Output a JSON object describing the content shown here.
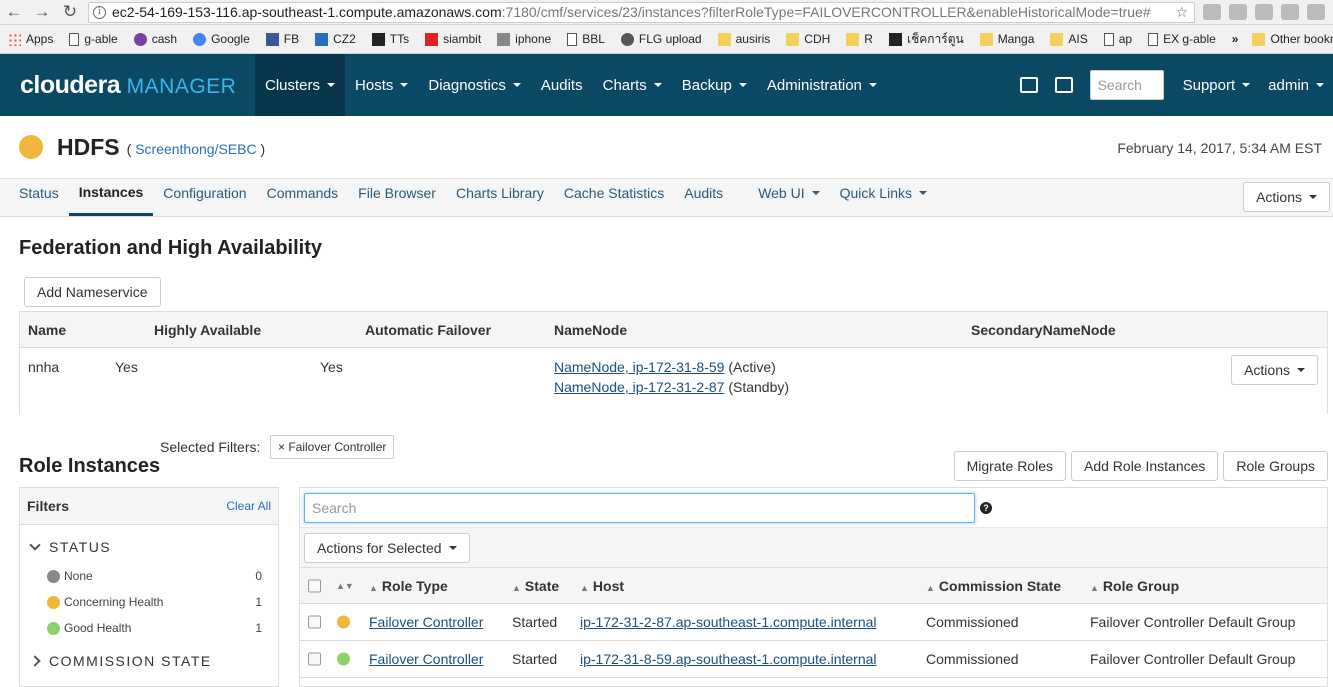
{
  "browser": {
    "url_host": "ec2-54-169-153-116.ap-southeast-1.compute.amazonaws.com",
    "url_path": ":7180/cmf/services/23/instances?filterRoleType=FAILOVERCONTROLLER&enableHistoricalMode=true#",
    "bookmarks": [
      "Apps",
      "g-able",
      "cash",
      "Google",
      "FB",
      "CZ2",
      "TTs",
      "siambit",
      "iphone",
      "BBL",
      "FLG upload",
      "ausiris",
      "CDH",
      "R",
      "เช็คการ์ตูน",
      "Manga",
      "AIS",
      "ap",
      "EX g-able",
      "»",
      "Other bookmarks"
    ]
  },
  "header": {
    "logo_bold": "cloudera",
    "logo_light": "MANAGER",
    "nav": [
      "Clusters",
      "Hosts",
      "Diagnostics",
      "Audits",
      "Charts",
      "Backup",
      "Administration"
    ],
    "search_placeholder": "Search",
    "support": "Support",
    "user": "admin"
  },
  "service": {
    "name": "HDFS",
    "cluster_prefix": "(",
    "cluster": "Screenthong/SEBC",
    "cluster_suffix": ")",
    "datetime": "February 14, 2017, 5:34 AM EST",
    "status_color": "#f0b63d"
  },
  "tabs": [
    "Status",
    "Instances",
    "Configuration",
    "Commands",
    "File Browser",
    "Charts Library",
    "Cache Statistics",
    "Audits",
    "Web UI",
    "Quick Links"
  ],
  "tab_actions": "Actions",
  "federation": {
    "title": "Federation and High Availability",
    "add_button": "Add Nameservice",
    "columns": [
      "Name",
      "Highly Available",
      "Automatic Failover",
      "NameNode",
      "SecondaryNameNode"
    ],
    "row": {
      "name": "nnha",
      "highly_available": "Yes",
      "automatic_failover": "Yes",
      "namenode1_link": "NameNode, ip-172-31-8-59",
      "namenode1_state": "(Active)",
      "namenode2_link": "NameNode, ip-172-31-2-87",
      "namenode2_state": "(Standby)",
      "actions": "Actions"
    }
  },
  "role_instances": {
    "title": "Role Instances",
    "selected_filters_label": "Selected Filters:",
    "filter_chip": "× Failover Controller",
    "buttons": [
      "Migrate Roles",
      "Add Role Instances",
      "Role Groups"
    ],
    "filters": {
      "title": "Filters",
      "clear_all": "Clear All",
      "status_group": "STATUS",
      "status_items": [
        {
          "label": "None",
          "count": "0",
          "color": "#888888"
        },
        {
          "label": "Concerning Health",
          "count": "1",
          "color": "#f0b63d"
        },
        {
          "label": "Good Health",
          "count": "1",
          "color": "#8ad36b"
        }
      ],
      "commission_group": "COMMISSION STATE"
    },
    "search_placeholder": "Search",
    "actions_for_selected": "Actions for Selected",
    "columns": [
      "Role Type",
      "State",
      "Host",
      "Commission State",
      "Role Group"
    ],
    "rows": [
      {
        "health_color": "#f0b63d",
        "role_type": "Failover Controller",
        "state": "Started",
        "host": "ip-172-31-2-87.ap-southeast-1.compute.internal",
        "commission_state": "Commissioned",
        "role_group": "Failover Controller Default Group"
      },
      {
        "health_color": "#8ad36b",
        "role_type": "Failover Controller",
        "state": "Started",
        "host": "ip-172-31-8-59.ap-southeast-1.compute.internal",
        "commission_state": "Commissioned",
        "role_group": "Failover Controller Default Group"
      }
    ]
  }
}
